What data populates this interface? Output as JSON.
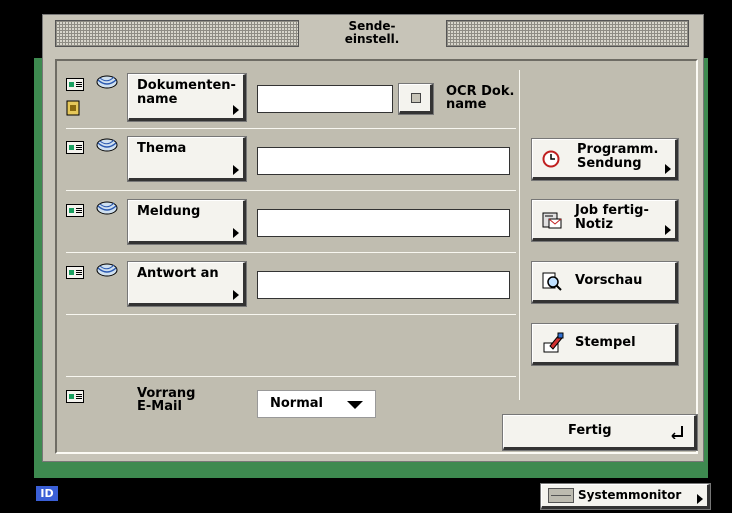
{
  "header": {
    "title_line1": "Sende-",
    "title_line2": "einstell."
  },
  "rows": {
    "doc_name": {
      "button_line1": "Dokumenten-",
      "button_line2": "name",
      "value": ""
    },
    "ocr": {
      "label_line1": "OCR Dok.",
      "label_line2": "name"
    },
    "subject": {
      "button": "Thema",
      "value": ""
    },
    "message": {
      "button": "Meldung",
      "value": ""
    },
    "reply_to": {
      "button": "Antwort an",
      "value": ""
    },
    "priority": {
      "label_line1": "Vorrang",
      "label_line2": "E-Mail",
      "selected": "Normal"
    }
  },
  "side": {
    "timer_line1": "Programm.",
    "timer_line2": "Sendung",
    "notify_line1": "Job fertig-",
    "notify_line2": "Notiz",
    "preview": "Vorschau",
    "stamp": "Stempel"
  },
  "footer": {
    "done": "Fertig",
    "id_badge": "ID",
    "system_monitor": "Systemmonitor"
  },
  "colors": {
    "frame_green": "#3e8a50",
    "panel": "#c7c4b8",
    "button": "#f4f3ee",
    "id_blue": "#3a5fd6"
  },
  "icons": [
    "email-card-icon",
    "fax-globe-icon",
    "file-icon",
    "clock-icon",
    "job-notify-icon",
    "magnifier-icon",
    "stamp-icon",
    "enter-arrow-icon",
    "monitor-icon"
  ]
}
